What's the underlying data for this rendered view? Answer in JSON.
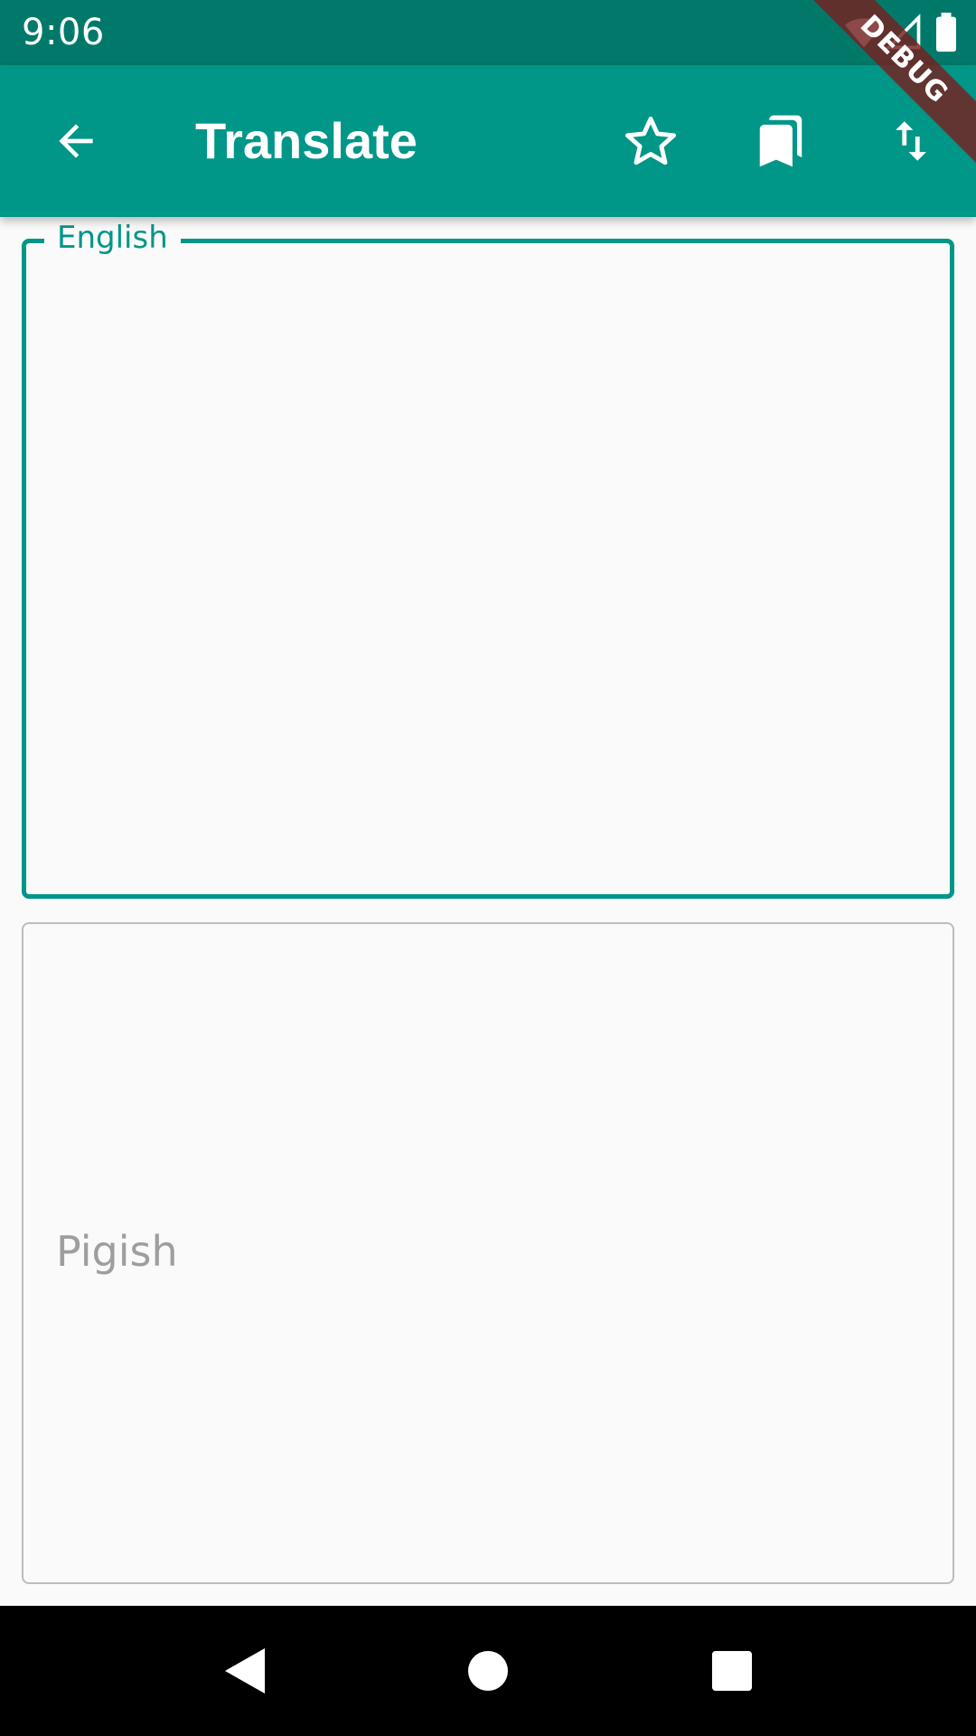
{
  "status_bar": {
    "time": "9:06",
    "icons": [
      "wifi-icon",
      "signal-icon",
      "battery-icon"
    ]
  },
  "app_bar": {
    "title": "Translate",
    "leading_icon": "arrow-back-icon",
    "actions": [
      "star-outline-icon",
      "bookmarks-icon",
      "swap-vert-icon"
    ]
  },
  "debug_banner": {
    "label": "DEBUG"
  },
  "source": {
    "label": "English",
    "value": ""
  },
  "target": {
    "label": "Pigish",
    "value": ""
  },
  "nav_bar": {
    "icons": [
      "nav-back-icon",
      "nav-home-icon",
      "nav-recents-icon"
    ]
  },
  "colors": {
    "status_bar": "#00796b",
    "primary": "#009688",
    "background": "#fafafa",
    "banner": "#752020",
    "hint": "#9e9e9e",
    "outline": "#bdbdbd"
  }
}
